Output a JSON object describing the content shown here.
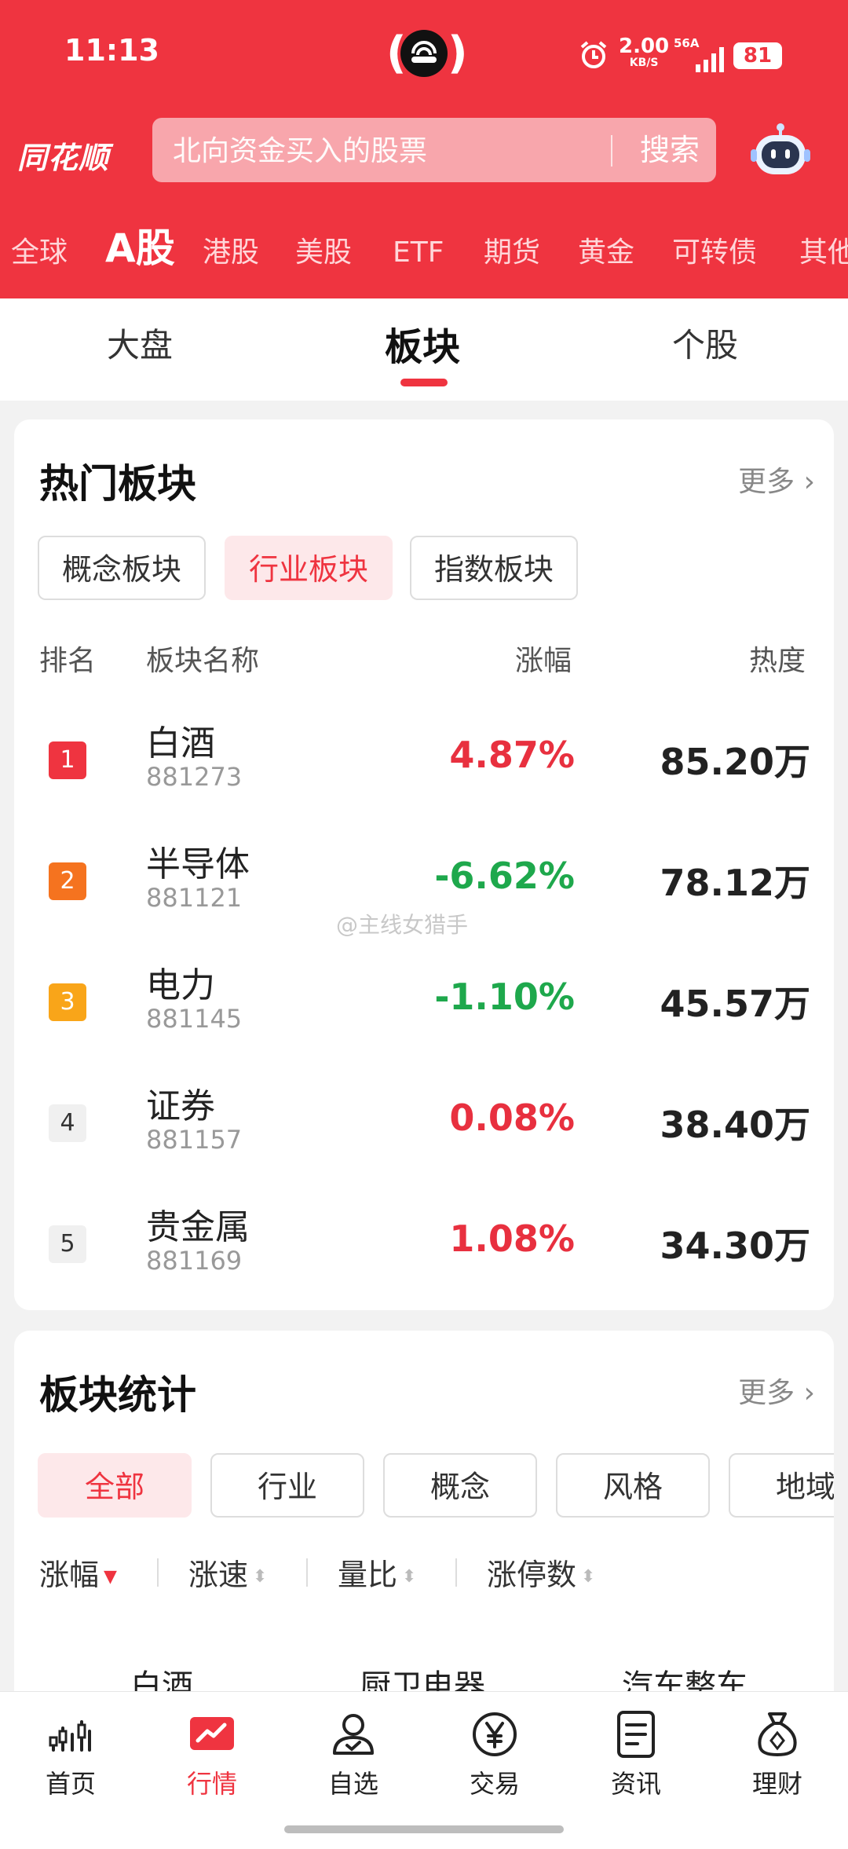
{
  "status": {
    "time": "11:13",
    "speed": "2.00",
    "speed_unit": "KB/S",
    "network": "56A",
    "battery": "81"
  },
  "header": {
    "logo": "同花顺",
    "search_placeholder": "北向资金买入的股票",
    "search_button": "搜索"
  },
  "market_tabs": [
    "全球",
    "A股",
    "港股",
    "美股",
    "ETF",
    "期货",
    "黄金",
    "可转债",
    "其他"
  ],
  "market_tab_active": "A股",
  "sub_tabs": [
    "大盘",
    "板块",
    "个股"
  ],
  "sub_tab_active": "板块",
  "hot": {
    "title": "热门板块",
    "more": "更多",
    "chips": [
      "概念板块",
      "行业板块",
      "指数板块"
    ],
    "chip_active": "行业板块",
    "headers": {
      "rank": "排名",
      "name": "板块名称",
      "change": "涨幅",
      "heat": "热度"
    },
    "rows": [
      {
        "rank": "1",
        "name": "白酒",
        "code": "881273",
        "change": "4.87%",
        "heat": "85.20万",
        "dir": "up"
      },
      {
        "rank": "2",
        "name": "半导体",
        "code": "881121",
        "change": "-6.62%",
        "heat": "78.12万",
        "dir": "down"
      },
      {
        "rank": "3",
        "name": "电力",
        "code": "881145",
        "change": "-1.10%",
        "heat": "45.57万",
        "dir": "down"
      },
      {
        "rank": "4",
        "name": "证券",
        "code": "881157",
        "change": "0.08%",
        "heat": "38.40万",
        "dir": "up"
      },
      {
        "rank": "5",
        "name": "贵金属",
        "code": "881169",
        "change": "1.08%",
        "heat": "34.30万",
        "dir": "up"
      }
    ]
  },
  "stats": {
    "title": "板块统计",
    "more": "更多",
    "chips": [
      "全部",
      "行业",
      "概念",
      "风格",
      "地域"
    ],
    "chip_active": "全部",
    "sort": [
      "涨幅",
      "涨速",
      "量比",
      "涨停数"
    ],
    "sort_active": "涨幅",
    "peek": [
      "白酒",
      "厨卫电器",
      "汽车整车"
    ]
  },
  "watermark": "@主线女猎手",
  "nav": [
    {
      "label": "首页",
      "icon": "chart-bars-icon"
    },
    {
      "label": "行情",
      "icon": "trend-icon"
    },
    {
      "label": "自选",
      "icon": "user-check-icon"
    },
    {
      "label": "交易",
      "icon": "yen-icon"
    },
    {
      "label": "资讯",
      "icon": "news-icon"
    },
    {
      "label": "理财",
      "icon": "moneybag-icon"
    }
  ],
  "nav_active": "行情",
  "colors": {
    "brand": "#ef3440",
    "up": "#e8303f",
    "down": "#1ea84c"
  }
}
